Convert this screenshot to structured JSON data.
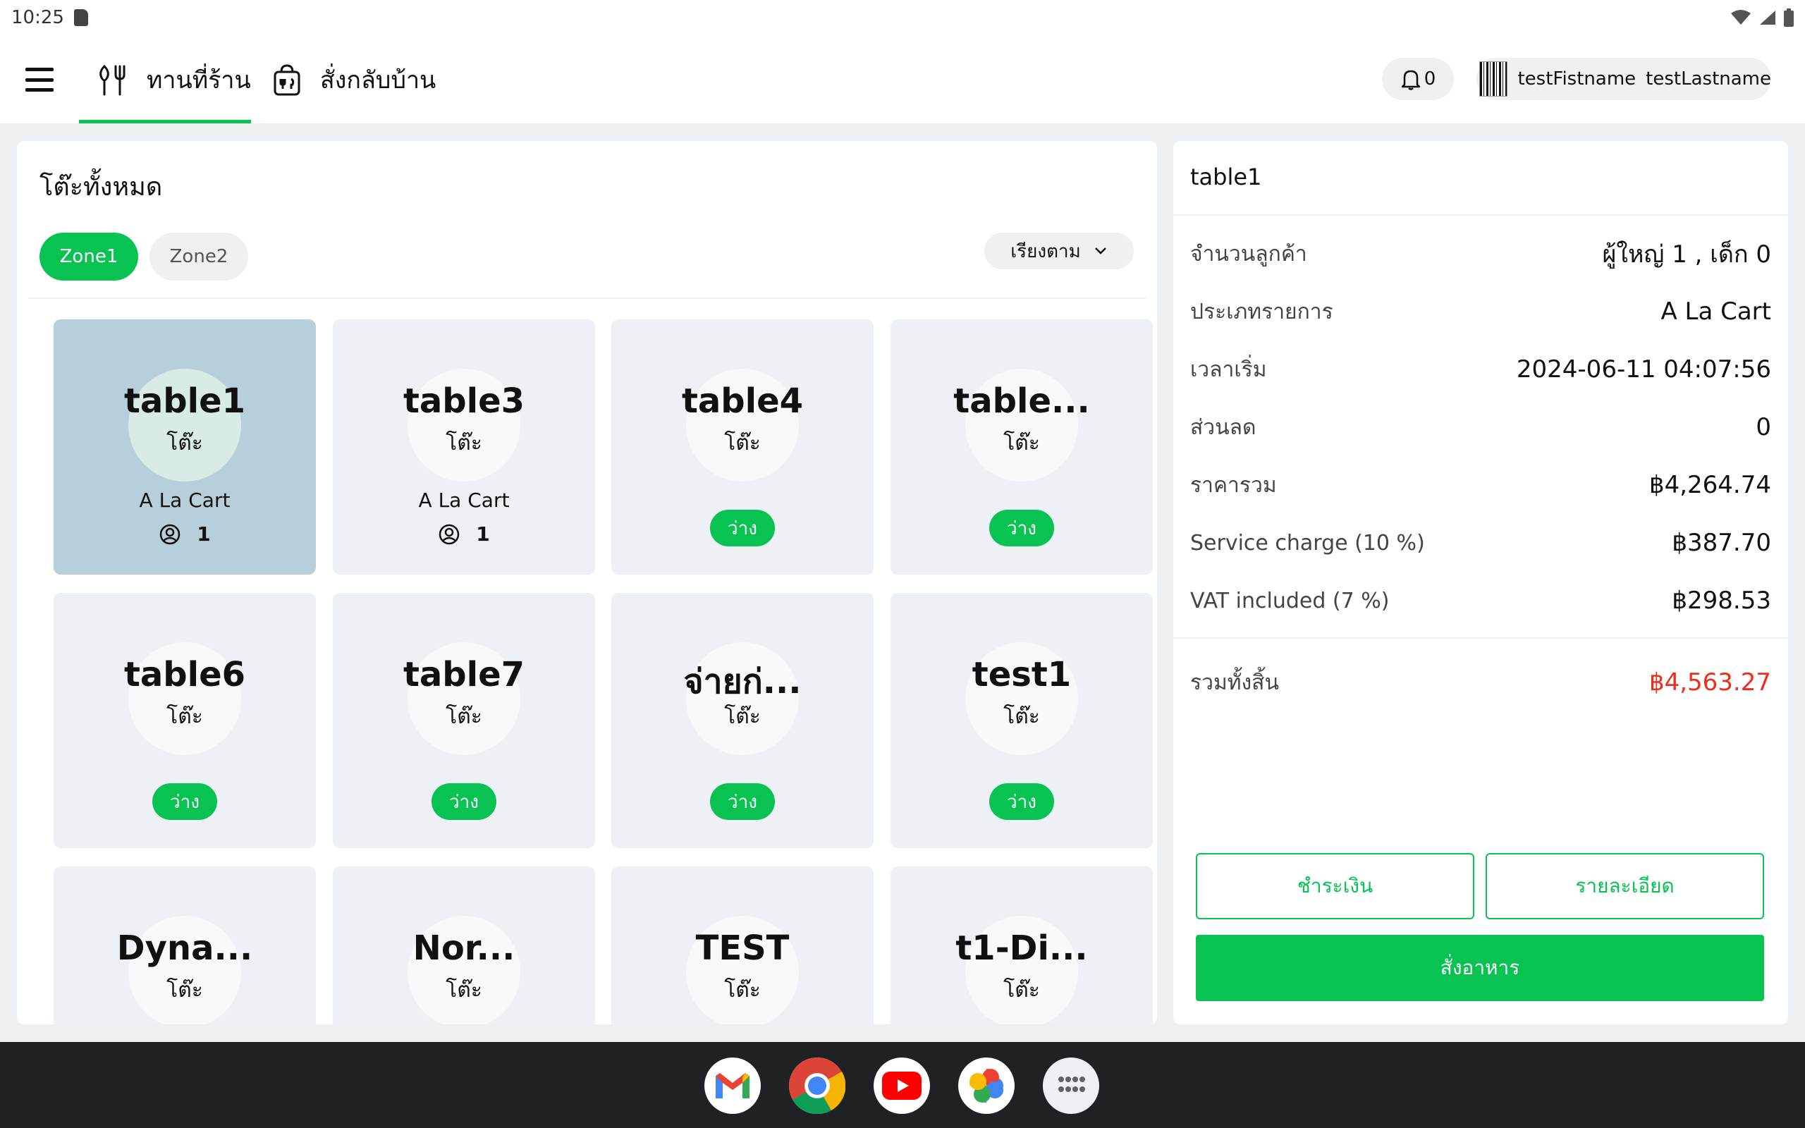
{
  "status_bar": {
    "time": "10:25"
  },
  "nav": {
    "tabs": [
      {
        "label": "ทานที่ร้าน",
        "icon": "fork-knife-icon",
        "active": true
      },
      {
        "label": "สั่งกลับบ้าน",
        "icon": "takeaway-bag-icon",
        "active": false
      }
    ],
    "notification_count": "0",
    "user": {
      "first": "testFistname",
      "last": "testLastname"
    }
  },
  "tables_panel": {
    "title": "โต๊ะทั้งหมด",
    "zones": [
      "Zone1",
      "Zone2"
    ],
    "active_zone": "Zone1",
    "sort_label": "เรียงตาม",
    "tables": [
      {
        "name": "table1",
        "kind": "โต๊ะ",
        "type": "A La Cart",
        "guests": "1",
        "status": "",
        "selected": true
      },
      {
        "name": "table3",
        "kind": "โต๊ะ",
        "type": "A La Cart",
        "guests": "1",
        "status": "",
        "selected": false
      },
      {
        "name": "table4",
        "kind": "โต๊ะ",
        "type": "",
        "guests": "",
        "status": "ว่าง",
        "selected": false
      },
      {
        "name": "table...",
        "kind": "โต๊ะ",
        "type": "",
        "guests": "",
        "status": "ว่าง",
        "selected": false
      },
      {
        "name": "table6",
        "kind": "โต๊ะ",
        "type": "",
        "guests": "",
        "status": "ว่าง",
        "selected": false
      },
      {
        "name": "table7",
        "kind": "โต๊ะ",
        "type": "",
        "guests": "",
        "status": "ว่าง",
        "selected": false
      },
      {
        "name": "จ่ายก่...",
        "kind": "โต๊ะ",
        "type": "",
        "guests": "",
        "status": "ว่าง",
        "selected": false
      },
      {
        "name": "test1",
        "kind": "โต๊ะ",
        "type": "",
        "guests": "",
        "status": "ว่าง",
        "selected": false
      },
      {
        "name": "Dyna...",
        "kind": "โต๊ะ",
        "type": "",
        "guests": "",
        "status": "",
        "selected": false
      },
      {
        "name": "Nor...",
        "kind": "โต๊ะ",
        "type": "",
        "guests": "",
        "status": "",
        "selected": false
      },
      {
        "name": "TEST",
        "kind": "โต๊ะ",
        "type": "",
        "guests": "",
        "status": "",
        "selected": false
      },
      {
        "name": "t1-Di...",
        "kind": "โต๊ะ",
        "type": "",
        "guests": "",
        "status": "",
        "selected": false
      }
    ]
  },
  "detail": {
    "title": "table1",
    "rows": [
      {
        "label": "จำนวนลูกค้า",
        "value": "ผู้ใหญ่ 1 , เด็ก 0"
      },
      {
        "label": "ประเภทรายการ",
        "value": "A La Cart"
      },
      {
        "label": "เวลาเริ่ม",
        "value": "2024-06-11 04:07:56"
      },
      {
        "label": "ส่วนลด",
        "value": "0"
      },
      {
        "label": "ราคารวม",
        "value": "฿4,264.74"
      },
      {
        "label": "Service charge (10 %)",
        "value": "฿387.70"
      },
      {
        "label": "VAT included (7 %)",
        "value": "฿298.53"
      }
    ],
    "total": {
      "label": "รวมทั้งสิ้น",
      "value": "฿4,563.27"
    },
    "buttons": {
      "pay": "ชำระเงิน",
      "details": "รายละเอียด",
      "order": "สั่งอาหาร"
    }
  },
  "dock": [
    {
      "icon": "gmail-icon"
    },
    {
      "icon": "chrome-icon"
    },
    {
      "icon": "youtube-icon"
    },
    {
      "icon": "photos-icon"
    },
    {
      "icon": "app-drawer-icon"
    }
  ],
  "colors": {
    "accent": "#08c252",
    "total": "#ee2d1d",
    "selected_card": "#b6cfda",
    "card": "#edf1f5"
  }
}
